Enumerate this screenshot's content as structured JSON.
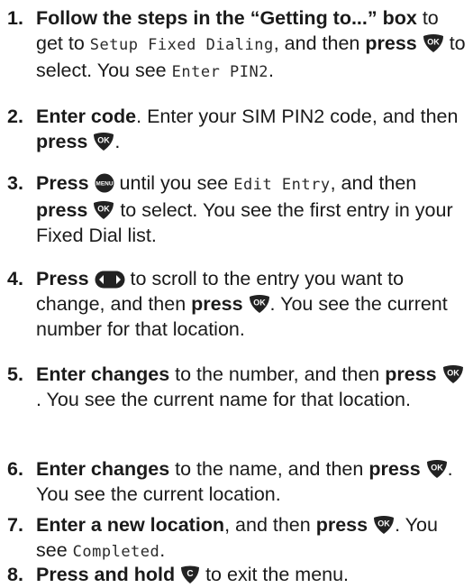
{
  "steps": [
    {
      "number": "1.",
      "bold1": "Follow the steps in the “Getting to...” box",
      "text1": " to get to ",
      "lcd1": "Setup Fixed Dialing",
      "text2": ", and then ",
      "bold2": "press",
      "text3": " to select. You see ",
      "lcd2": "Enter PIN2",
      "text4": "."
    },
    {
      "number": "2.",
      "bold1": "Enter code",
      "text1": ". Enter your SIM PIN2 code, and then ",
      "bold2": "press",
      "text2": "."
    },
    {
      "number": "3.",
      "bold1": "Press",
      "text1": " until you see ",
      "lcd1": "Edit Entry",
      "text2": ", and then ",
      "bold2": "press",
      "text3": " to select. You see the first entry in your Fixed Dial list."
    },
    {
      "number": "4.",
      "bold1": "Press",
      "text1": " to scroll to the entry you want to change, and then ",
      "bold2": "press",
      "text2": ". You see the current number for that location."
    },
    {
      "number": "5.",
      "bold1": "Enter changes",
      "text1": " to the number, and then ",
      "bold2": "press",
      "text2": ". You see the current name for that location."
    },
    {
      "number": "6.",
      "bold1": "Enter changes",
      "text1": " to the name, and then ",
      "bold2": "press",
      "text2": ". You see the current location."
    },
    {
      "number": "7.",
      "bold1": "Enter a new location",
      "text1": ", and then ",
      "bold2": "press",
      "text2": ". You see ",
      "lcd1": "Completed",
      "text3": "."
    },
    {
      "number": "8.",
      "bold1": "Press and hold",
      "text1": " to exit the menu."
    }
  ],
  "icons": {
    "ok_label": "OK",
    "menu_label": "MENU",
    "clear_label": "C"
  }
}
